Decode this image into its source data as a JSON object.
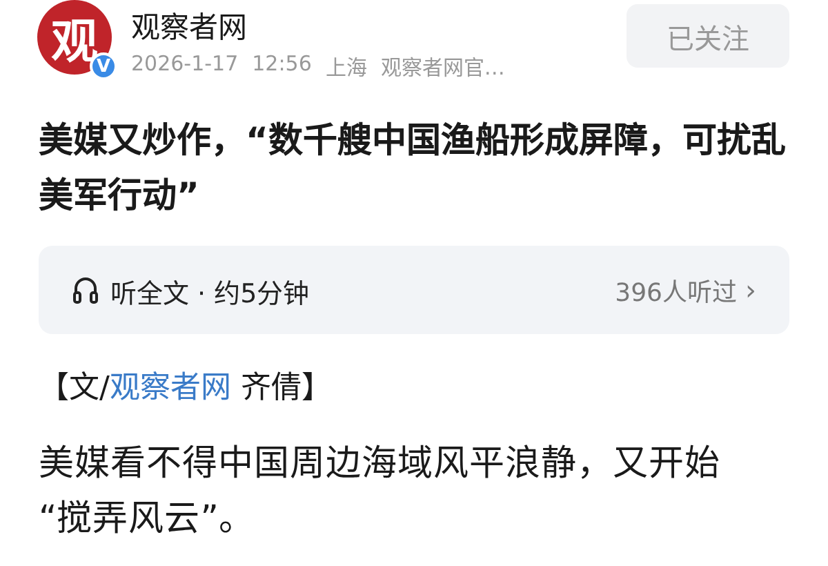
{
  "author": {
    "logo_text": "观",
    "verified_mark": "V",
    "name": "观察者网",
    "date": "2026-1-17",
    "time": "12:56",
    "location": "上海",
    "description": "观察者网官…"
  },
  "follow_button": {
    "label": "已关注",
    "followed": true
  },
  "headline": "美媒又炒作，“数千艘中国渔船形成屏障，可扰乱美军行动”",
  "audio_bar": {
    "label": "听全文 · 约5分钟",
    "listeners": "396人听过",
    "chevron": "›"
  },
  "byline": {
    "open": "【文/",
    "source": "观察者网",
    "rest": " 齐倩】"
  },
  "paragraphs": [
    "美媒看不得中国周边海域风平浪静，又开始“搅弄风云”。"
  ]
}
